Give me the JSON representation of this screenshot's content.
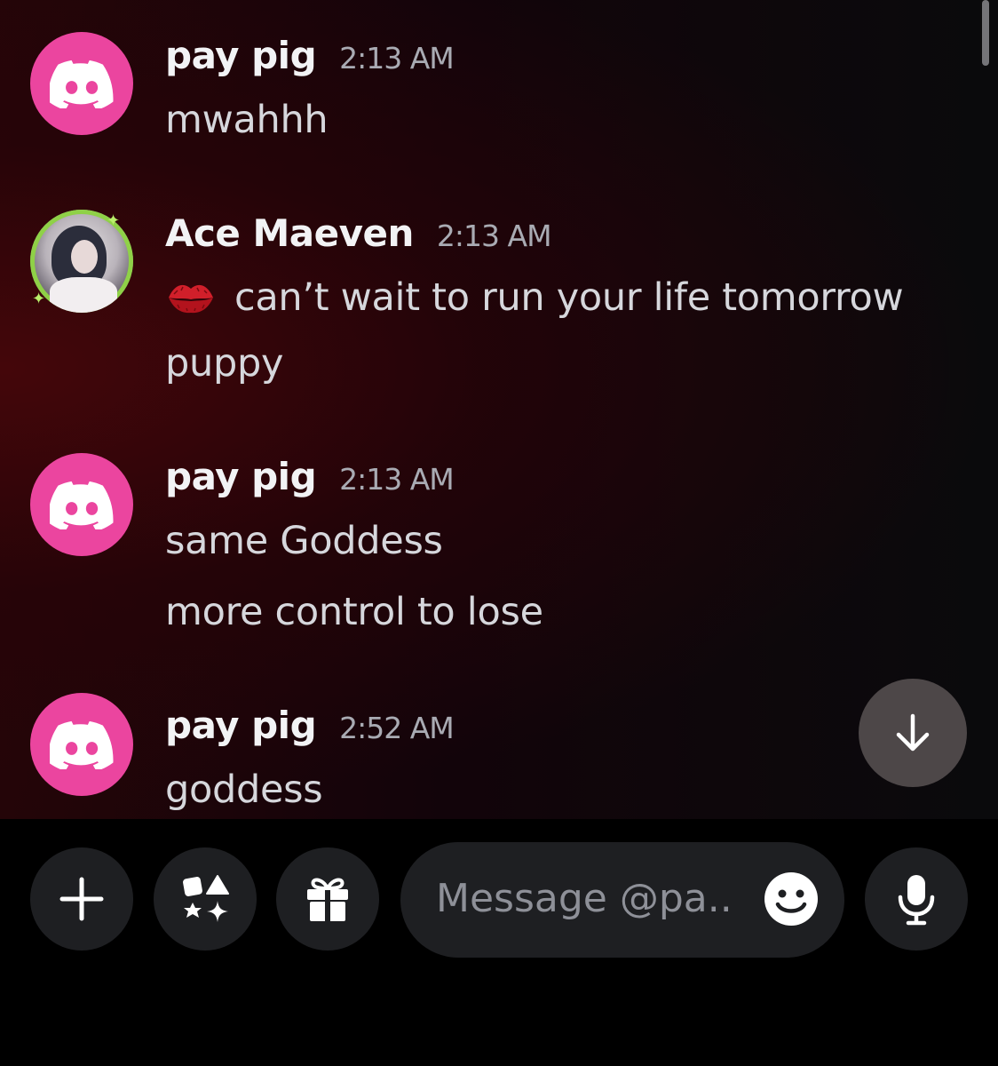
{
  "messages": [
    {
      "username": "pay pig",
      "time": "2:13 AM",
      "avatar_icon": "discord-logo-icon",
      "lines": [
        "mwahhh"
      ]
    },
    {
      "username": "Ace Maeven",
      "time": "2:13 AM",
      "avatar_icon": "profile-photo",
      "emoji": "kiss-mark-emoji",
      "lines": [
        "can’t wait to run your life tomorrow",
        "puppy"
      ]
    },
    {
      "username": "pay pig",
      "time": "2:13 AM",
      "avatar_icon": "discord-logo-icon",
      "lines": [
        "same Goddess",
        "more control to lose"
      ]
    },
    {
      "username": "pay pig",
      "time": "2:52 AM",
      "avatar_icon": "discord-logo-icon",
      "lines": [
        "goddess"
      ]
    }
  ],
  "composer": {
    "placeholder": "Message @pa.."
  },
  "colors": {
    "discord_avatar": "#eb459f",
    "avatar_ring": "#8fd147",
    "button_bg": "#1e1f22"
  }
}
